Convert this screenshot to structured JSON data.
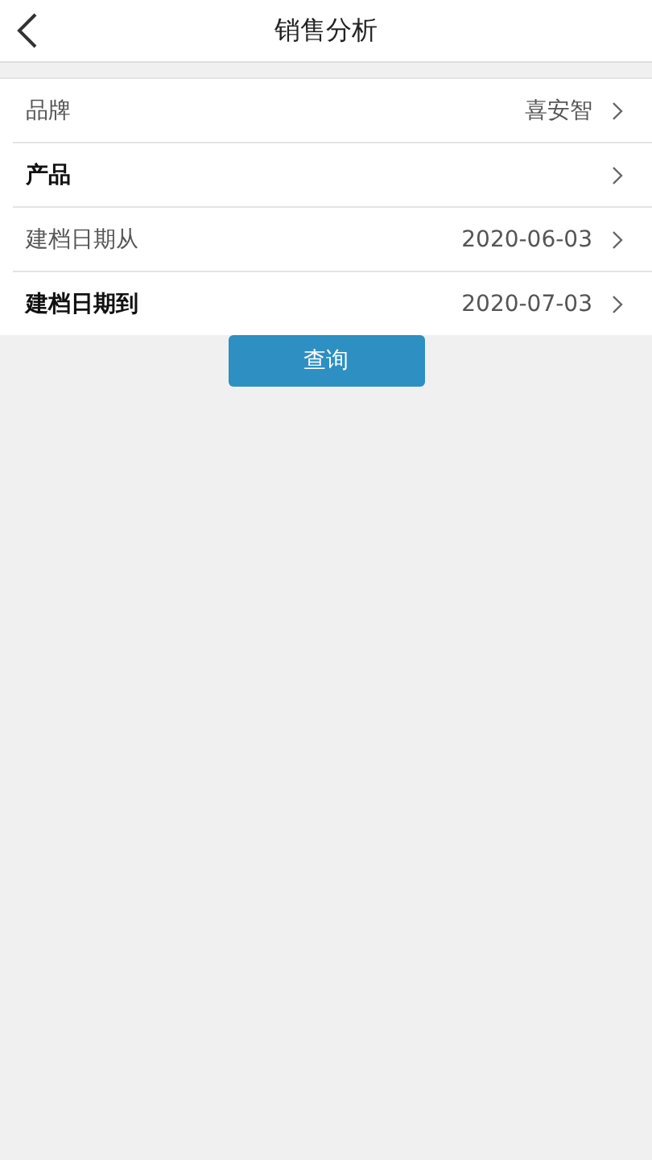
{
  "header": {
    "title": "销售分析"
  },
  "rows": [
    {
      "label": "品牌",
      "value": "喜安智",
      "emphasis": false
    },
    {
      "label": "产品",
      "emphasis": true
    },
    {
      "label": "建档日期从",
      "value": "2020-06-03",
      "emphasis": false
    },
    {
      "label": "建档日期到",
      "value": "2020-07-03",
      "emphasis": true
    }
  ],
  "query_button": {
    "label": "查询"
  }
}
